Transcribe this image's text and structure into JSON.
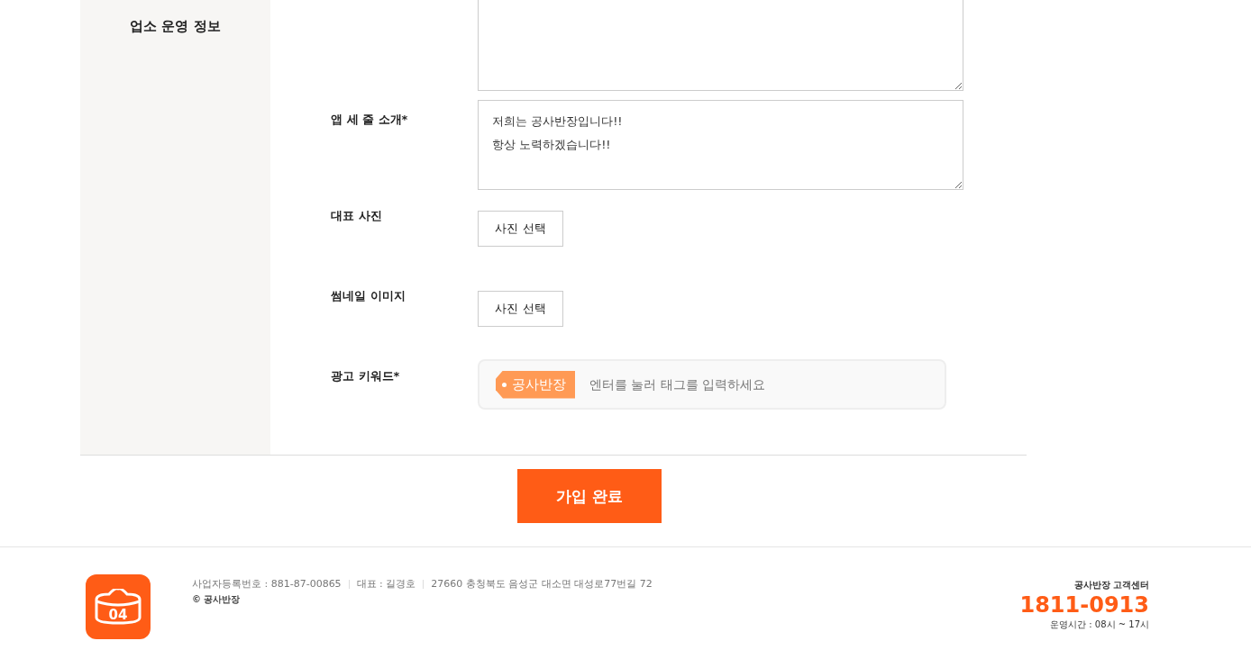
{
  "sidebar": {
    "title": "업소 운영 정보"
  },
  "form": {
    "rows": [
      {
        "kind": "textarea",
        "value": ""
      },
      {
        "kind": "textarea",
        "label": "앱 세 줄 소개*",
        "value": "저희는 공사반장입니다!!\n항상 노력하겠습니다!!"
      },
      {
        "kind": "file",
        "label": "대표 사진",
        "button": "사진 선택"
      },
      {
        "kind": "file",
        "label": "썸네일 이미지",
        "button": "사진 선택"
      },
      {
        "kind": "tags",
        "label": "광고 키워드*",
        "tags": [
          "공사반장"
        ],
        "placeholder": "엔터를 눌러 태그를 입력하세요"
      }
    ]
  },
  "submit": "가입 완료",
  "footer": {
    "logo_text": "04",
    "info": [
      "사업자등록번호 : 881-87-00865",
      "대표 : 길경호",
      "27660 충청북도 음성군 대소면 대성로77번길 72"
    ],
    "copyright": "© 공사반장",
    "center_title": "공사반장 고객센터",
    "phone": "1811-0913",
    "hours": "운영시간 : 08시 ~ 17시"
  }
}
